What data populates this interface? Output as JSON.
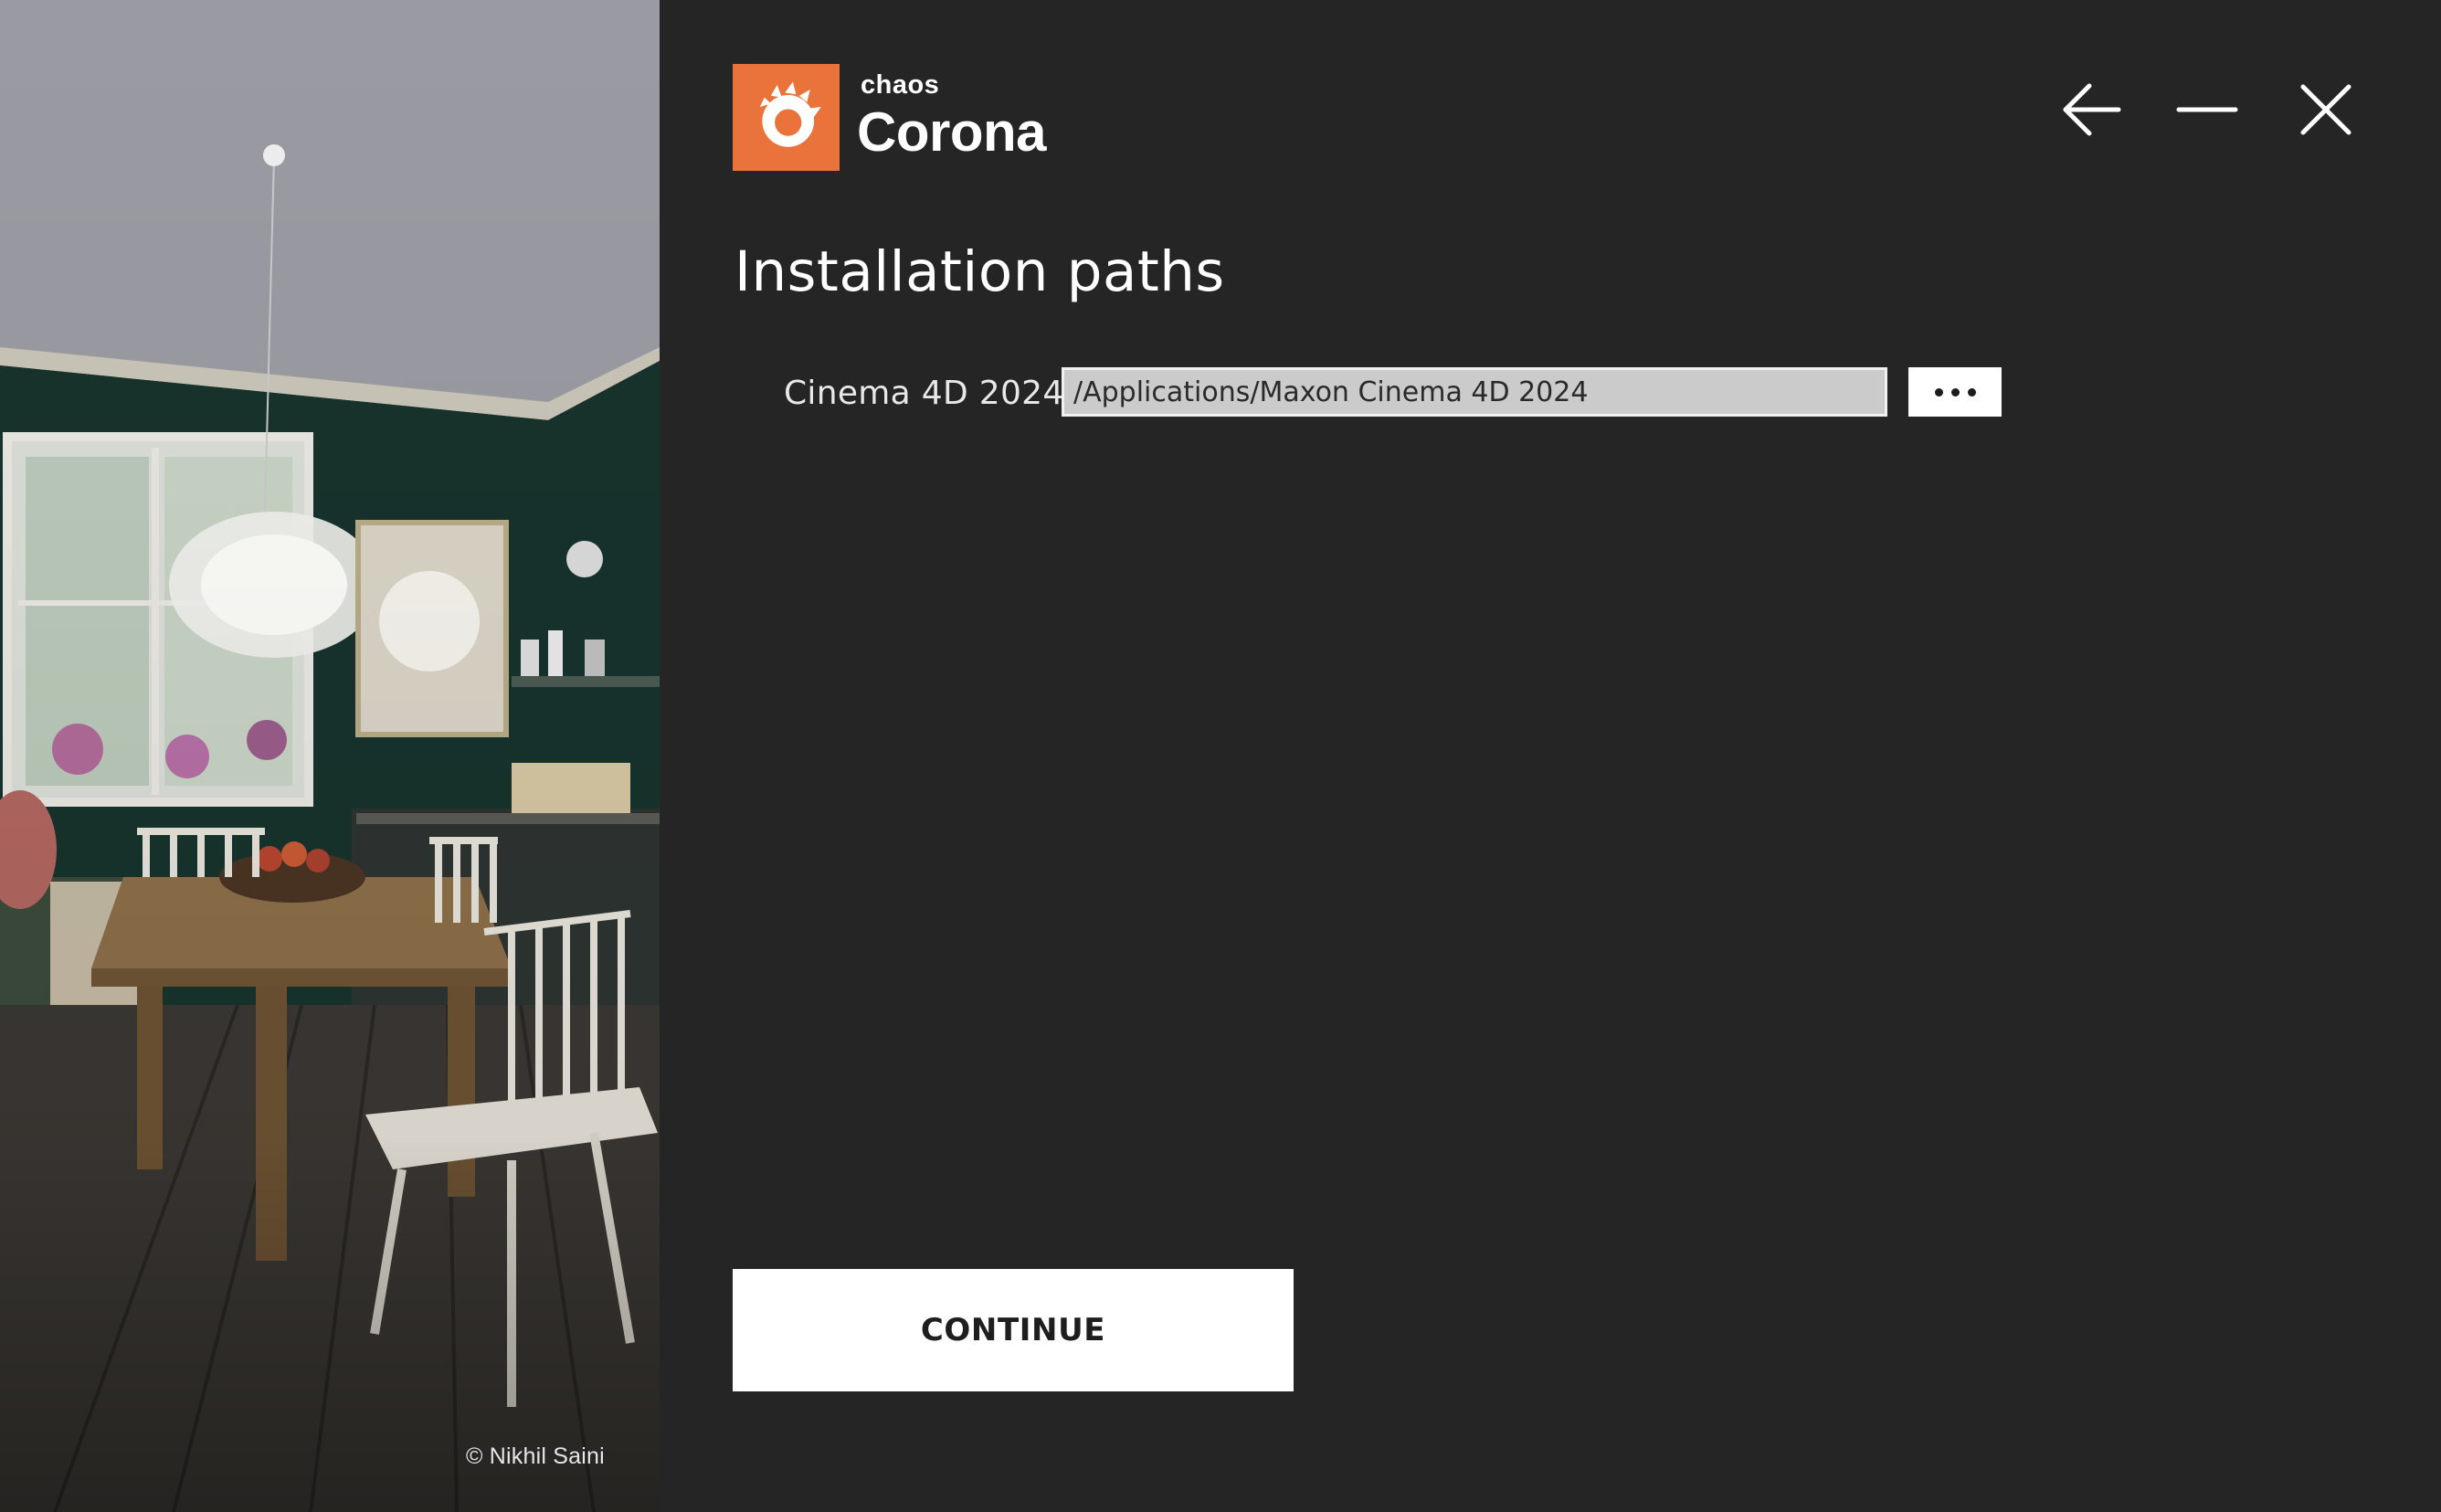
{
  "brand": {
    "company": "chaos",
    "product": "Corona",
    "accent_color": "#e9733b",
    "logo_icon": "corona-sun-icon"
  },
  "window_controls": {
    "back_icon": "arrow-left-icon",
    "minimize_icon": "minimize-icon",
    "close_icon": "close-icon"
  },
  "page": {
    "title": "Installation paths"
  },
  "paths": [
    {
      "label": "Cinema 4D 2024",
      "value": "/Applications/Maxon Cinema 4D 2024",
      "browse_icon": "ellipsis-icon"
    }
  ],
  "photo": {
    "credit": "© Nikhil Saini"
  },
  "actions": {
    "continue_label": "CONTINUE"
  }
}
